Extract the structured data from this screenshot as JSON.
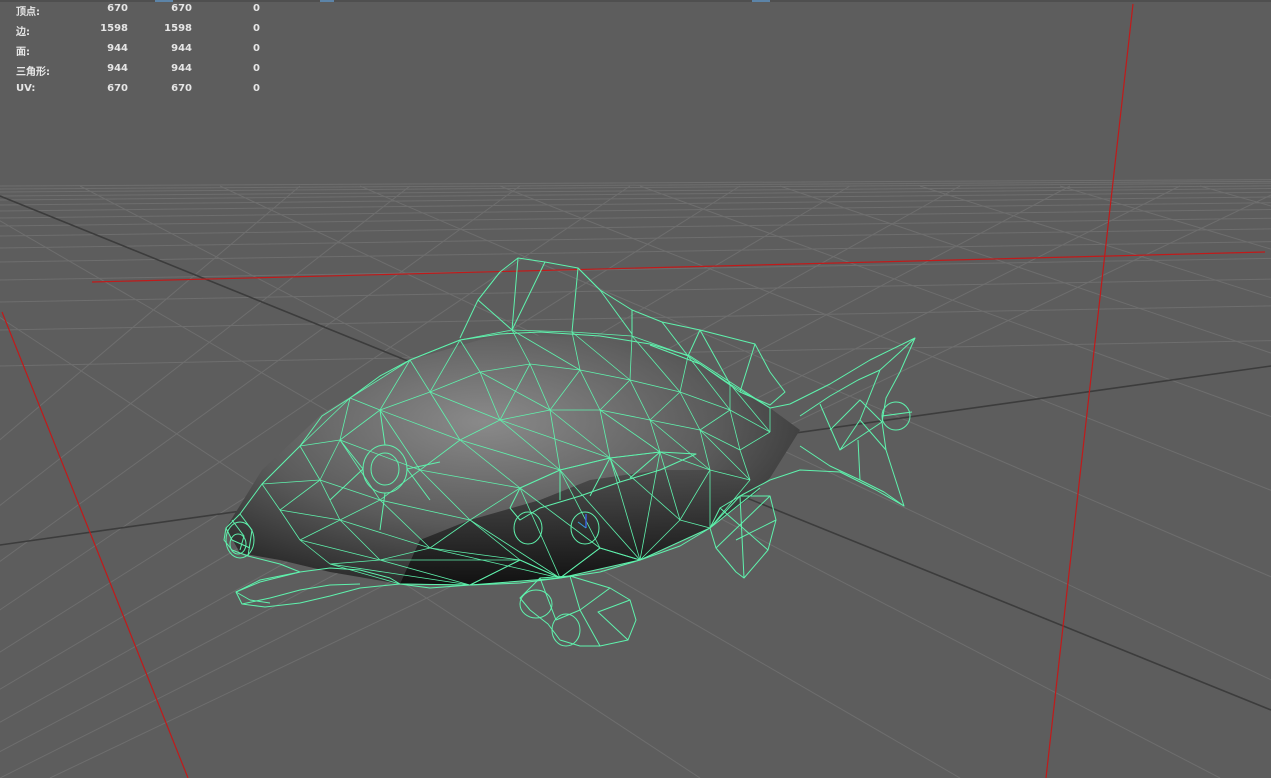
{
  "viewport": {
    "background_color": "#5d5d5d",
    "grid_color": "#6e6e6e",
    "grid_axis_color": "#3c3c3c",
    "axis_line_color": "#c11a1a",
    "wireframe_color": "#5ff2ad"
  },
  "heads_up_display": {
    "rows": [
      {
        "label": "顶点:",
        "values": [
          "670",
          "670",
          "0"
        ]
      },
      {
        "label": "边:",
        "values": [
          "1598",
          "1598",
          "0"
        ]
      },
      {
        "label": "面:",
        "values": [
          "944",
          "944",
          "0"
        ]
      },
      {
        "label": "三角形:",
        "values": [
          "944",
          "944",
          "0"
        ]
      },
      {
        "label": "UV:",
        "values": [
          "670",
          "670",
          "0"
        ]
      }
    ]
  },
  "model": {
    "icon": "fish-wireframe-mesh",
    "selected": true
  }
}
